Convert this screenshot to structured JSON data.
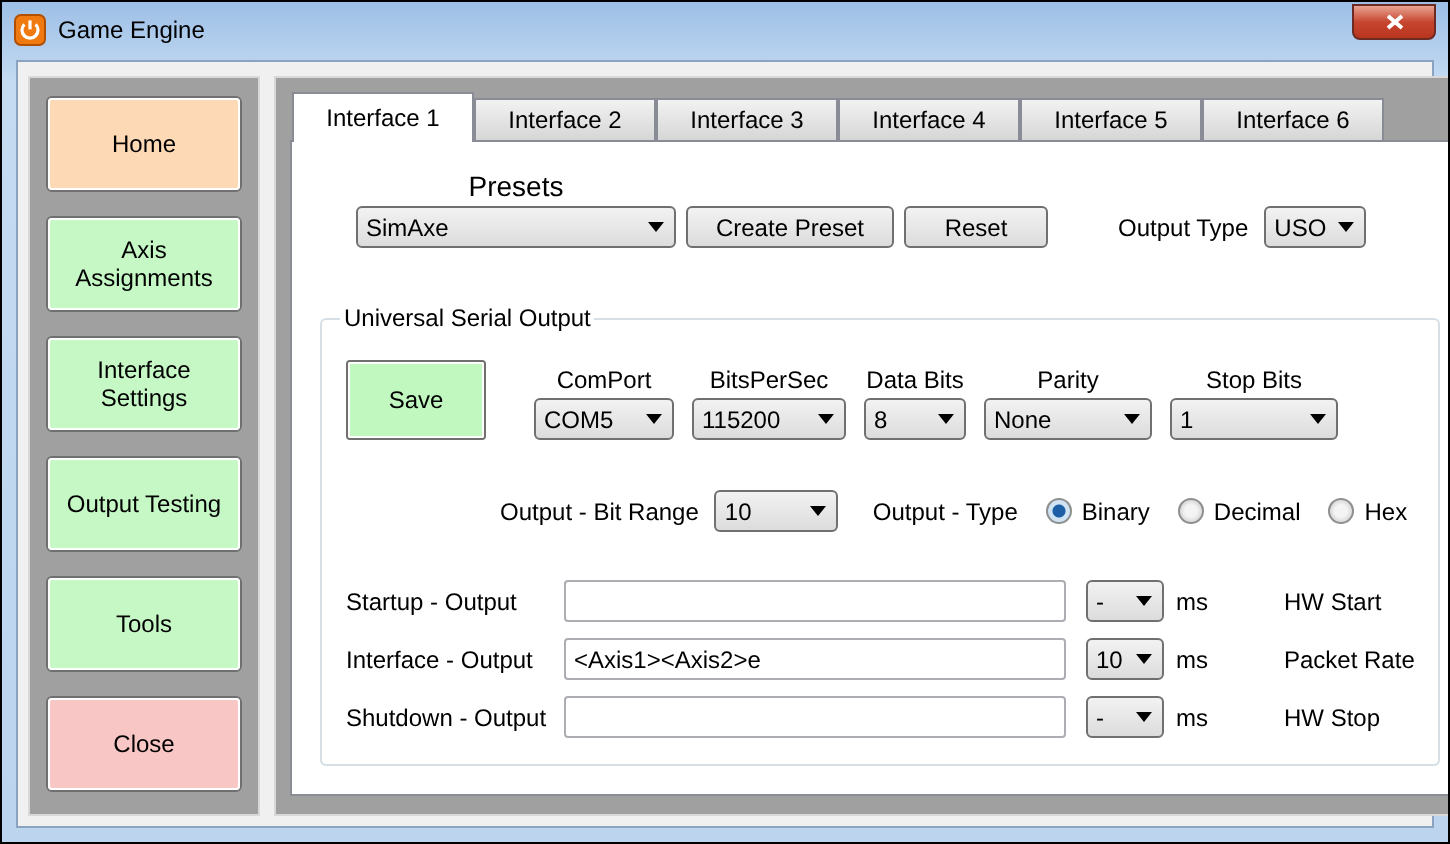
{
  "window": {
    "title": "Game Engine"
  },
  "nav": [
    {
      "label": "Home",
      "color": "#fdd9b5"
    },
    {
      "label": "Axis Assignments",
      "color": "#c6f8c6"
    },
    {
      "label": "Interface Settings",
      "color": "#c6f8c6"
    },
    {
      "label": "Output Testing",
      "color": "#c6f8c6"
    },
    {
      "label": "Tools",
      "color": "#c6f8c6"
    },
    {
      "label": "Close",
      "color": "#f9c6c6"
    }
  ],
  "tabs": [
    {
      "label": "Interface 1",
      "selected": true
    },
    {
      "label": "Interface 2",
      "selected": false
    },
    {
      "label": "Interface 3",
      "selected": false
    },
    {
      "label": "Interface 4",
      "selected": false
    },
    {
      "label": "Interface 5",
      "selected": false
    },
    {
      "label": "Interface 6",
      "selected": false
    }
  ],
  "presets": {
    "label": "Presets",
    "value": "SimAxe",
    "buttons": [
      "Create Preset",
      "Reset"
    ]
  },
  "output_type": {
    "label": "Output Type",
    "value": "USO"
  },
  "group": {
    "title": "Universal Serial Output",
    "save": "Save",
    "settings": [
      {
        "label": "ComPort",
        "value": "COM5"
      },
      {
        "label": "BitsPerSec",
        "value": "115200"
      },
      {
        "label": "Data Bits",
        "value": "8"
      },
      {
        "label": "Parity",
        "value": "None"
      },
      {
        "label": "Stop Bits",
        "value": "1"
      }
    ],
    "bit_range": {
      "label": "Output - Bit Range",
      "value": "10"
    },
    "type": {
      "label": "Output - Type",
      "options": [
        {
          "label": "Binary",
          "selected": true
        },
        {
          "label": "Decimal",
          "selected": false
        },
        {
          "label": "Hex",
          "selected": false
        }
      ]
    },
    "rows": [
      {
        "label": "Startup - Output",
        "rate": "-",
        "unit": "ms",
        "note": "HW Start"
      },
      {
        "label": "Interface - Output",
        "value": "<Axis1><Axis2>e",
        "rate": "10",
        "unit": "ms",
        "note": "Packet Rate"
      },
      {
        "label": "Shutdown - Output",
        "rate": "-",
        "unit": "ms",
        "note": "HW Stop"
      }
    ]
  }
}
